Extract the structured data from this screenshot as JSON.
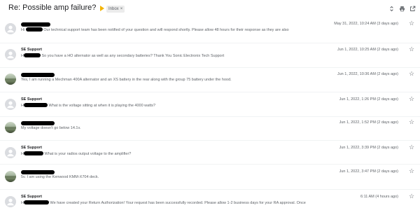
{
  "header": {
    "subject": "Re: Possible amp failure?",
    "label_chip": "Inbox",
    "label_chip_close": "×",
    "importance_color": "#f4b400"
  },
  "messages": [
    {
      "sender": "",
      "avatar": "default-avatar-icon",
      "greeting": "Hi",
      "snippet": "Our technical support team has been notified of your question and will respond shortly. Please allow 48 hours for their response as they are also",
      "date": "May 31, 2022, 10:24 AM (3 days ago)"
    },
    {
      "sender": "SE Support",
      "avatar": "default-avatar-icon",
      "greeting": "H",
      "snippet": "So you have a HO alternator as well as any secondary batteries? Thank You Sonic Electronix Tech Support",
      "date": "Jun 1, 2022, 10:25 AM (2 days ago)"
    },
    {
      "sender": "",
      "avatar": "photo",
      "greeting": "",
      "snippet": "Yes, I am running a Mechman 400A alternator and an XS battery in the rear along with the group 75 battery under the hood.",
      "date": "Jun 1, 2022, 10:36 AM (2 days ago)"
    },
    {
      "sender": "SE Support",
      "avatar": "default-avatar-icon",
      "greeting": "H",
      "snippet": "What is the voltage sitting at when it is playing the 4000 watts?",
      "date": "Jun 1, 2022, 1:26 PM (2 days ago)"
    },
    {
      "sender": "",
      "avatar": "photo",
      "greeting": "",
      "snippet": "My voltage doesn't go below 14.1v.",
      "date": "Jun 1, 2022, 1:52 PM (2 days ago)"
    },
    {
      "sender": "SE Support",
      "avatar": "default-avatar-icon",
      "greeting": "H",
      "snippet": "What is your radios output voltage to the amplifier?",
      "date": "Jun 1, 2022, 3:39 PM (2 days ago)"
    },
    {
      "sender": "",
      "avatar": "photo",
      "greeting": "",
      "snippet": "5v. I am using the Kenwood KMM-X704 deck.",
      "date": "Jun 1, 2022, 3:47 PM (2 days ago)"
    },
    {
      "sender": "SE Support",
      "avatar": "default-avatar-icon",
      "greeting": "H",
      "snippet": "We have created your Return Authorization! Your request has been successfully recorded. Please allow 1-2 business days for your RA approval. Once",
      "date": "6:11 AM (4 hours ago)"
    }
  ]
}
